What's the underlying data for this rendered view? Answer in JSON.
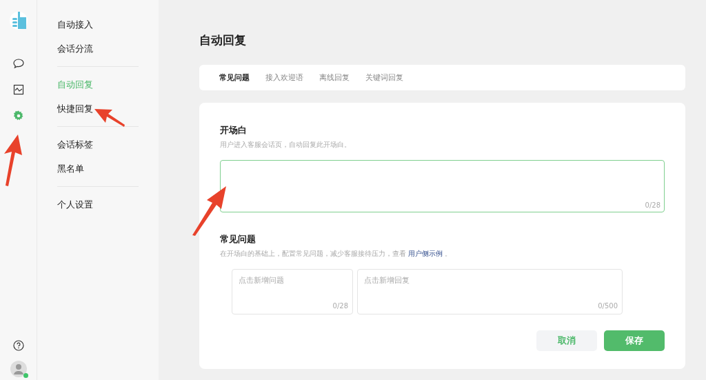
{
  "rail": {
    "items": [
      {
        "kind": "chat",
        "selected": false
      },
      {
        "kind": "chart",
        "selected": false
      },
      {
        "kind": "settings",
        "selected": true
      }
    ],
    "status_online": true
  },
  "menu": {
    "groups": [
      [
        {
          "label": "自动接入",
          "selected": false
        },
        {
          "label": "会话分流",
          "selected": false
        }
      ],
      [
        {
          "label": "自动回复",
          "selected": true
        },
        {
          "label": "快捷回复",
          "selected": false
        }
      ],
      [
        {
          "label": "会话标签",
          "selected": false
        },
        {
          "label": "黑名单",
          "selected": false
        }
      ],
      [
        {
          "label": "个人设置",
          "selected": false
        }
      ]
    ]
  },
  "page_title": "自动回复",
  "tabs": [
    {
      "label": "常见问题",
      "selected": true
    },
    {
      "label": "接入欢迎语",
      "selected": false
    },
    {
      "label": "离线回复",
      "selected": false
    },
    {
      "label": "关键词回复",
      "selected": false
    }
  ],
  "opening": {
    "title": "开场白",
    "hint": "用户进入客服会话页，自动回复此开场白。",
    "counter": "0/28",
    "focused": true
  },
  "faq": {
    "title": "常见问题",
    "hint_before": "在开场白的基础上，配置常见问题，减少客服接待压力，查看",
    "link": "用户侧示例",
    "hint_after": "。",
    "question": {
      "placeholder": "点击新增问题",
      "counter": "0/28"
    },
    "answer": {
      "placeholder": "点击新增回复",
      "counter": "0/500"
    }
  },
  "buttons": [
    {
      "label": "取消",
      "kind": "secondary"
    },
    {
      "label": "保存",
      "kind": "primary"
    }
  ]
}
